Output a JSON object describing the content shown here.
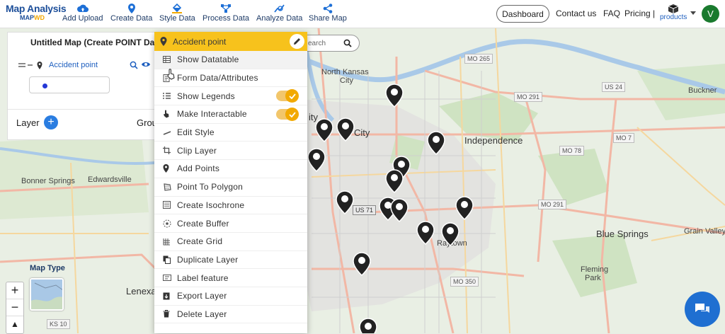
{
  "brand": {
    "name": "Map Analysis",
    "sub_left": "MAP",
    "sub_right": "WD"
  },
  "toolbar": {
    "add_upload": "Add Upload",
    "create_data": "Create Data",
    "style_data": "Style Data",
    "process_data": "Process Data",
    "analyze_data": "Analyze Data",
    "share_map": "Share Map"
  },
  "nav": {
    "dashboard": "Dashboard",
    "contact": "Contact us",
    "faq": "FAQ",
    "pricing": "Pricing |",
    "products": "products",
    "avatar_initial": "V"
  },
  "panel": {
    "map_title": "Untitled Map (Create POINT Dat",
    "layer_name": "Accident point",
    "layer_label": "Layer",
    "group_label": "Grou",
    "swatch_color": "#2438d6"
  },
  "search": {
    "placeholder": "earch"
  },
  "menu": {
    "title": "Accident point",
    "items": [
      {
        "label": "Show Datatable",
        "icon": "table-icon"
      },
      {
        "label": "Form Data/Attributes",
        "icon": "form-icon"
      },
      {
        "label": "Show Legends",
        "icon": "list-icon",
        "toggle": true
      },
      {
        "label": "Make Interactable",
        "icon": "hand-icon",
        "toggle": true
      },
      {
        "label": "Edit Style",
        "icon": "brush-icon"
      },
      {
        "label": "Clip Layer",
        "icon": "crop-icon"
      },
      {
        "label": "Add Points",
        "icon": "map-pin-icon"
      },
      {
        "label": "Point To Polygon",
        "icon": "polygon-icon"
      },
      {
        "label": "Create Isochrone",
        "icon": "isochrone-icon"
      },
      {
        "label": "Create Buffer",
        "icon": "buffer-icon"
      },
      {
        "label": "Create Grid",
        "icon": "grid-icon"
      },
      {
        "label": "Duplicate Layer",
        "icon": "duplicate-icon"
      },
      {
        "label": "Label feature",
        "icon": "label-icon"
      },
      {
        "label": "Export Layer",
        "icon": "export-icon"
      },
      {
        "label": "Delete Layer",
        "icon": "trash-icon"
      }
    ]
  },
  "map": {
    "places": {
      "north_kansas_city_1": "North Kansas",
      "north_kansas_city_2": "City",
      "independence": "Independence",
      "blue_springs": "Blue Springs",
      "grain_valley": "Grain Valley",
      "buckner": "Buckner",
      "bonner_springs": "Bonner Springs",
      "edwardsville": "Edwardsville",
      "lenexa": "Lenexa",
      "raytown": "Raytown",
      "fleming_1": "Fleming",
      "fleming_2": "Park",
      "kansas_city_partial": "ity",
      "kansas_city_partial_2": "City"
    },
    "shields": [
      "MO 265",
      "MO 291",
      "US 24",
      "MO 7",
      "MO 78",
      "US 71",
      "MO 350",
      "KS 10",
      "MO 291"
    ],
    "map_type_label": "Map Type"
  },
  "colors": {
    "accent": "#f7c21c",
    "brand": "#1d4f9a",
    "toggle": "#f2a900",
    "chat": "#1f6fd1"
  }
}
